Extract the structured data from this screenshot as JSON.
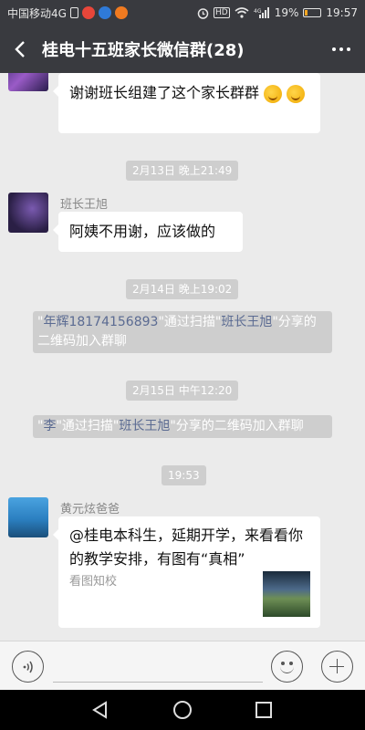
{
  "status_bar": {
    "carrier": "中国移动4G",
    "network": "4G",
    "battery_percent": "19%",
    "time": "19:57",
    "hd_label": "HD",
    "battery_fill_fraction": 0.19
  },
  "header": {
    "title": "桂电十五班家长微信群(28)",
    "back_icon": "chevron-left-icon",
    "more_icon": "more-dots-icon"
  },
  "messages": {
    "m1": {
      "text": "谢谢班长组建了这个家长群群"
    },
    "t1": {
      "text": "2月13日 晚上21:49"
    },
    "m2": {
      "sender": "班长王旭",
      "text": "阿姨不用谢，应该做的"
    },
    "t2": {
      "text": "2月14日 晚上19:02"
    },
    "s1": {
      "quote_open": "\"",
      "name1": "年辉18174156893",
      "mid": "\"通过扫描\"",
      "name2": "班长王旭",
      "tail": "\"分享的二维码加入群聊"
    },
    "t3": {
      "text": "2月15日 中午12:20"
    },
    "s2": {
      "quote_open": "\"",
      "name1": "李",
      "mid": "\"通过扫描\"",
      "name2": "班长王旭",
      "tail": "\"分享的二维码加入群聊"
    },
    "t4": {
      "text": "19:53"
    },
    "m3": {
      "sender": "黄元炫爸爸",
      "card_title": "@桂电本科生，延期开学，来看看你的教学安排，有图有“真相”",
      "card_source": "看图知校"
    }
  },
  "input_bar": {
    "placeholder": "",
    "voice_icon": "voice-icon",
    "emoji_icon": "emoji-icon",
    "plus_icon": "plus-icon"
  },
  "nav": {
    "back_icon": "nav-back-icon",
    "home_icon": "nav-home-icon",
    "recent_icon": "nav-recent-icon"
  },
  "colors": {
    "header_bg": "#393a3f",
    "chat_bg": "#ebebeb",
    "system_pill": "#cecece",
    "highlight_name": "#5b6b92"
  }
}
